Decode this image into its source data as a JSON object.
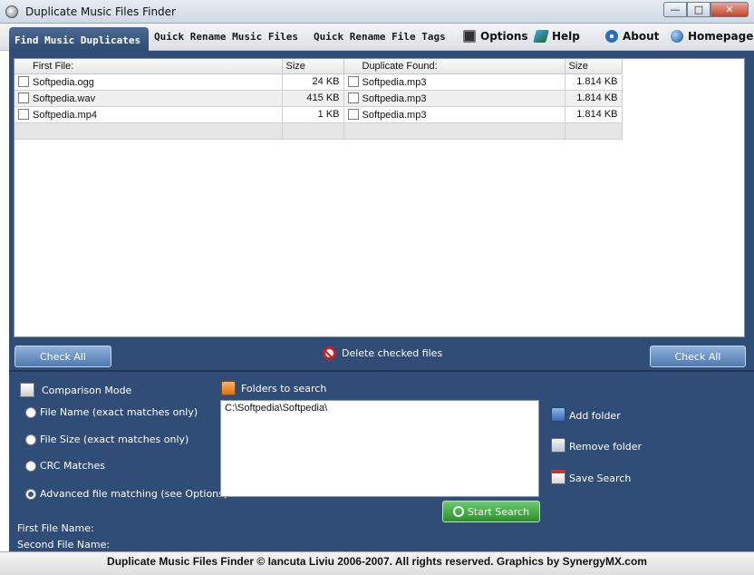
{
  "window": {
    "title": "Duplicate Music Files Finder"
  },
  "tabs": [
    {
      "label": "Find Music Duplicates",
      "active": true
    },
    {
      "label": "Quick Rename Music Files",
      "active": false
    },
    {
      "label": "Quick Rename File Tags",
      "active": false
    }
  ],
  "menu": {
    "options": {
      "label": "Options",
      "icon": "options-icon"
    },
    "help": {
      "label": "Help",
      "icon": "help-icon"
    },
    "about": {
      "label": "About",
      "icon": "about-icon"
    },
    "homepage": {
      "label": "Homepage",
      "icon": "globe-icon"
    }
  },
  "results": {
    "columns": [
      "First File:",
      "Size",
      "Duplicate Found:",
      "Size"
    ],
    "rows": [
      {
        "first_file": "Softpedia.ogg",
        "first_size": "24 KB",
        "duplicate": "Softpedia.mp3",
        "duplicate_size": "1.814 KB"
      },
      {
        "first_file": "Softpedia.wav",
        "first_size": "415 KB",
        "duplicate": "Softpedia.mp3",
        "duplicate_size": "1.814 KB"
      },
      {
        "first_file": "Softpedia.mp4",
        "first_size": "1 KB",
        "duplicate": "Softpedia.mp3",
        "duplicate_size": "1.814 KB"
      }
    ]
  },
  "actions": {
    "check_all_left": "Check All",
    "check_all_right": "Check All",
    "delete_checked": "Delete checked files"
  },
  "comparison": {
    "title": "Comparison Mode",
    "options": [
      {
        "label": "File Name (exact matches only)",
        "selected": false
      },
      {
        "label": "File Size (exact matches only)",
        "selected": false
      },
      {
        "label": "CRC Matches",
        "selected": false
      },
      {
        "label": "Advanced file matching (see Options)",
        "selected": true
      }
    ]
  },
  "folders": {
    "title": "Folders to search",
    "paths": "C:\\Softpedia\\Softpedia\\",
    "add_folder": "Add folder",
    "remove_folder": "Remove folder",
    "save_search": "Save Search",
    "start_search": "Start Search"
  },
  "status": {
    "first_file_name_label": "First File Name:",
    "second_file_name_label": "Second File Name:"
  },
  "footer": {
    "text": "Duplicate Music Files Finder © Iancuta Liviu 2006-2007. All rights reserved. Graphics by SynergyMX.com"
  },
  "colors": {
    "panel_bg": "#304d78",
    "button_blue": "#5f86bd",
    "start_green": "#3aa23a",
    "delete_red": "#d01d1d"
  }
}
